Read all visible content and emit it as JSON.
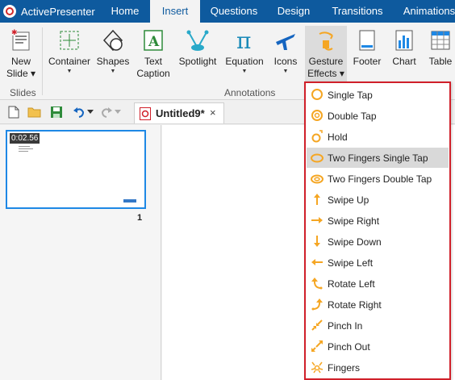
{
  "app": {
    "name": "ActivePresenter"
  },
  "tabs": [
    {
      "label": "Home"
    },
    {
      "label": "Insert"
    },
    {
      "label": "Questions"
    },
    {
      "label": "Design"
    },
    {
      "label": "Transitions"
    },
    {
      "label": "Animations"
    }
  ],
  "ribbon": {
    "new_slide": {
      "line1": "New",
      "line2": "Slide"
    },
    "container": "Container",
    "shapes": "Shapes",
    "text_caption": {
      "line1": "Text",
      "line2": "Caption"
    },
    "spotlight": "Spotlight",
    "equation": "Equation",
    "icons": "Icons",
    "gesture_effects": {
      "line1": "Gesture",
      "line2": "Effects"
    },
    "footer": "Footer",
    "chart": "Chart",
    "table": "Table",
    "groups": {
      "slides": "Slides",
      "annotations": "Annotations"
    }
  },
  "document": {
    "tab_title": "Untitled9*",
    "close_glyph": "×"
  },
  "slides_pane": {
    "thumbnail_time": "0:02.56",
    "slide_number": "1"
  },
  "gesture_menu": {
    "items": [
      {
        "label": "Single Tap",
        "icon": "single-tap-icon"
      },
      {
        "label": "Double Tap",
        "icon": "double-tap-icon"
      },
      {
        "label": "Hold",
        "icon": "hold-icon"
      },
      {
        "label": "Two Fingers Single Tap",
        "icon": "two-fingers-single-tap-icon"
      },
      {
        "label": "Two Fingers Double Tap",
        "icon": "two-fingers-double-tap-icon"
      },
      {
        "label": "Swipe Up",
        "icon": "swipe-up-icon"
      },
      {
        "label": "Swipe Right",
        "icon": "swipe-right-icon"
      },
      {
        "label": "Swipe Down",
        "icon": "swipe-down-icon"
      },
      {
        "label": "Swipe Left",
        "icon": "swipe-left-icon"
      },
      {
        "label": "Rotate Left",
        "icon": "rotate-left-icon"
      },
      {
        "label": "Rotate Right",
        "icon": "rotate-right-icon"
      },
      {
        "label": "Pinch In",
        "icon": "pinch-in-icon"
      },
      {
        "label": "Pinch Out",
        "icon": "pinch-out-icon"
      },
      {
        "label": "Fingers",
        "icon": "fingers-icon"
      }
    ],
    "highlighted_item": "Two Fingers Single Tap"
  },
  "colors": {
    "title_bar": "#0e5a9e",
    "gesture_orange": "#f5a623",
    "menu_border": "#d0202a",
    "selection_blue": "#1e88e5"
  }
}
